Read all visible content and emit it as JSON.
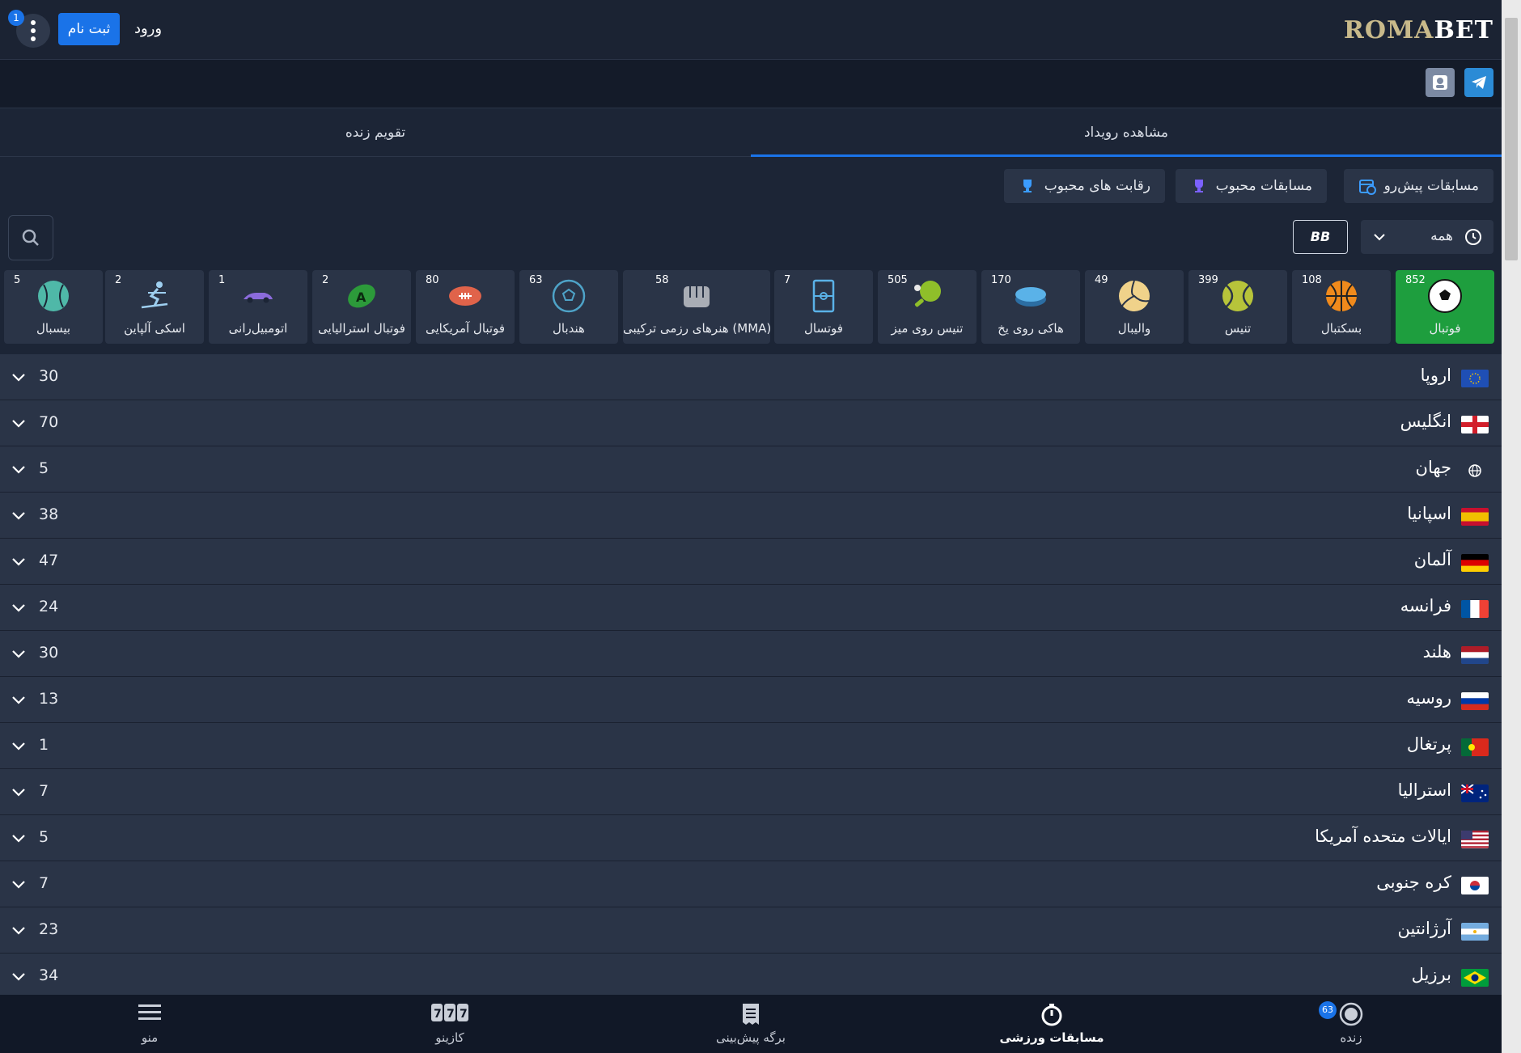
{
  "header": {
    "logo_part1": "ROMA",
    "logo_part2": "BET",
    "notif_count": "1",
    "register_label": "ثبت نام",
    "login_label": "ورود"
  },
  "tabs": {
    "events": "مشاهده رویداد",
    "live_calendar": "تقویم زنده"
  },
  "filters": [
    {
      "label": "مسابقات پیش‌رو",
      "icon": "calendar-clock-icon"
    },
    {
      "label": "مسابقات محبوب",
      "icon": "trophy-icon"
    },
    {
      "label": "رقابت های محبوب",
      "icon": "trophy-icon"
    }
  ],
  "time_filter": {
    "label": "همه"
  },
  "bb_label": "BB",
  "sports": [
    {
      "name": "فوتبال",
      "count": "852",
      "icon": "soccer-ball-icon",
      "active": true
    },
    {
      "name": "بسکتبال",
      "count": "108",
      "icon": "basketball-icon"
    },
    {
      "name": "تنیس",
      "count": "399",
      "icon": "tennis-ball-icon"
    },
    {
      "name": "والیبال",
      "count": "49",
      "icon": "volleyball-icon"
    },
    {
      "name": "هاکی روی یخ",
      "count": "170",
      "icon": "hockey-puck-icon"
    },
    {
      "name": "تنیس روی میز",
      "count": "505",
      "icon": "ping-pong-icon"
    },
    {
      "name": "فوتسال",
      "count": "7",
      "icon": "futsal-court-icon"
    },
    {
      "name": "هنرهای رزمی ترکیبی (MMA)",
      "count": "58",
      "icon": "fist-icon"
    },
    {
      "name": "هندبال",
      "count": "63",
      "icon": "handball-icon"
    },
    {
      "name": "فوتبال آمریکایی",
      "count": "80",
      "icon": "american-football-icon"
    },
    {
      "name": "فوتبال استرالیایی",
      "count": "2",
      "icon": "aussie-football-icon"
    },
    {
      "name": "اتومبیل‌رانی",
      "count": "1",
      "icon": "race-car-icon"
    },
    {
      "name": "اسکی آلپاین",
      "count": "2",
      "icon": "skier-icon"
    },
    {
      "name": "بیسبال",
      "count": "5",
      "icon": "baseball-icon"
    }
  ],
  "countries": [
    {
      "name": "اروپا",
      "count": "30",
      "flag": "eu"
    },
    {
      "name": "انگلیس",
      "count": "70",
      "flag": "england"
    },
    {
      "name": "جهان",
      "count": "5",
      "flag": "world"
    },
    {
      "name": "اسپانیا",
      "count": "38",
      "flag": "spain"
    },
    {
      "name": "آلمان",
      "count": "47",
      "flag": "germany"
    },
    {
      "name": "فرانسه",
      "count": "24",
      "flag": "france"
    },
    {
      "name": "هلند",
      "count": "30",
      "flag": "netherlands"
    },
    {
      "name": "روسیه",
      "count": "13",
      "flag": "russia"
    },
    {
      "name": "پرتغال",
      "count": "1",
      "flag": "portugal"
    },
    {
      "name": "استرالیا",
      "count": "7",
      "flag": "australia"
    },
    {
      "name": "ایالات متحده آمریکا",
      "count": "5",
      "flag": "usa"
    },
    {
      "name": "کره جنوبی",
      "count": "7",
      "flag": "korea"
    },
    {
      "name": "آرژانتین",
      "count": "23",
      "flag": "argentina"
    },
    {
      "name": "برزیل",
      "count": "34",
      "flag": "brazil"
    }
  ],
  "bottom_nav": {
    "live": "زنده",
    "live_badge": "63",
    "sports": "مسابقات ورزشی",
    "betslip": "برگه پیش‌بینی",
    "casino": "کازینو",
    "menu": "منو"
  },
  "colors": {
    "accent": "#1a73e8",
    "active_sport": "#1e9e3e",
    "panel": "#2a3447",
    "background": "#1c2536"
  }
}
